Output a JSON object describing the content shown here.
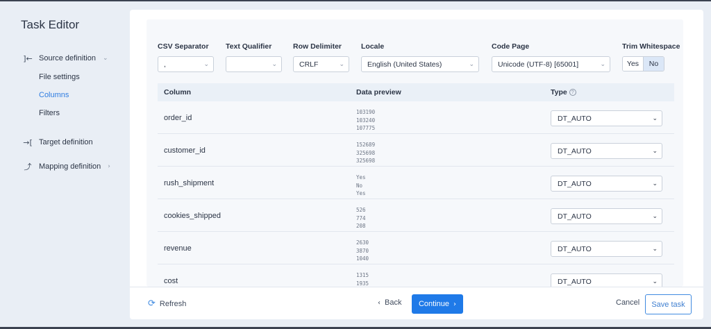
{
  "app": {
    "title": "Task Editor"
  },
  "sidebar": {
    "source": {
      "label": "Source definition",
      "icon": "source-icon"
    },
    "sub_items": [
      "File settings",
      "Columns",
      "Filters"
    ],
    "active_sub": "Columns",
    "target": {
      "label": "Target definition",
      "icon": "target-icon"
    },
    "mapping": {
      "label": "Mapping definition",
      "icon": "mapping-icon"
    }
  },
  "settings": {
    "csv_separator": {
      "label": "CSV Separator",
      "value": ","
    },
    "text_qualifier": {
      "label": "Text Qualifier",
      "value": ""
    },
    "row_delimiter": {
      "label": "Row Delimiter",
      "value": "CRLF"
    },
    "locale": {
      "label": "Locale",
      "value": "English (United States)"
    },
    "code_page": {
      "label": "Code Page",
      "value": "Unicode (UTF-8) [65001]"
    },
    "trim_whitespace": {
      "label": "Trim Whitespace",
      "yes": "Yes",
      "no": "No",
      "selected": "No"
    }
  },
  "table": {
    "headers": {
      "column": "Column",
      "preview": "Data preview",
      "type": "Type"
    },
    "rows": [
      {
        "name": "order_id",
        "preview": [
          "103190",
          "103240",
          "107775"
        ],
        "type": "DT_AUTO"
      },
      {
        "name": "customer_id",
        "preview": [
          "152689",
          "325698",
          "325698"
        ],
        "type": "DT_AUTO"
      },
      {
        "name": "rush_shipment",
        "preview": [
          "Yes",
          "No",
          "Yes"
        ],
        "type": "DT_AUTO"
      },
      {
        "name": "cookies_shipped",
        "preview": [
          "526",
          "774",
          "208"
        ],
        "type": "DT_AUTO"
      },
      {
        "name": "revenue",
        "preview": [
          "2630",
          "3870",
          "1040"
        ],
        "type": "DT_AUTO"
      },
      {
        "name": "cost",
        "preview": [
          "1315",
          "1935"
        ],
        "type": "DT_AUTO"
      }
    ]
  },
  "footer": {
    "refresh": "Refresh",
    "back": "Back",
    "continue": "Continue",
    "cancel": "Cancel",
    "save": "Save task"
  },
  "colors": {
    "accent": "#1f7ae8",
    "active_nav": "#2f7de1",
    "toggle_selected": "#dbe7f7"
  }
}
